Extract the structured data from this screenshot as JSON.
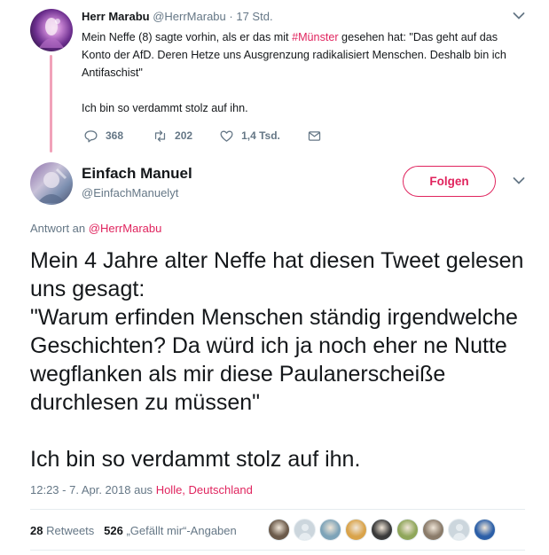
{
  "parent_tweet": {
    "author_name": "Herr Marabu",
    "author_handle": "@HerrMarabu",
    "separator": "·",
    "time": "17 Std.",
    "text_prefix": "Mein Neffe (8) sagte vorhin, als er das mit ",
    "hashtag": "#Münster",
    "text_suffix": " gesehen hat: \"Das geht auf das Konto der AfD. Deren Hetze uns Ausgrenzung radikalisiert Menschen. Deshalb bin ich Antifaschist\"",
    "text_second": "Ich bin so verdammt stolz auf ihn.",
    "replies": "368",
    "retweets": "202",
    "likes": "1,4 Tsd.",
    "caret": "⌄"
  },
  "main_tweet": {
    "author_name": "Einfach Manuel",
    "author_handle": "@EinfachManuelyt",
    "follow_label": "Folgen",
    "caret": "⌄",
    "reply_prefix": "Antwort an",
    "reply_mention": "@HerrMarabu",
    "text_lines": [
      "Mein 4 Jahre alter Neffe hat diesen Tweet gelesen uns gesagt:",
      "\"Warum erfinden Menschen ständig irgendwelche Geschichten? Da würd ich ja noch eher ne Nutte wegflanken als mir diese Paulanerscheiße durchlesen zu müssen\""
    ],
    "text_last": "Ich bin so verdammt stolz auf ihn.",
    "timestamp": "12:23 - 7. Apr. 2018 aus",
    "location": "Holle, Deutschland",
    "retweet_count": "28",
    "retweet_label": "Retweets",
    "like_count": "526",
    "like_label": "„Gefällt mir“-Angaben"
  },
  "liker_avatars": [
    {
      "name": "liker-avatar-1",
      "color": "#6b5a4a",
      "default": false
    },
    {
      "name": "liker-avatar-2",
      "color": "#ccd6dd",
      "default": true
    },
    {
      "name": "liker-avatar-3",
      "color": "#7da3b8",
      "default": false
    },
    {
      "name": "liker-avatar-4",
      "color": "#d9a34a",
      "default": false
    },
    {
      "name": "liker-avatar-5",
      "color": "#3a3a3a",
      "default": false
    },
    {
      "name": "liker-avatar-6",
      "color": "#8fa65a",
      "default": false
    },
    {
      "name": "liker-avatar-7",
      "color": "#8a7b6a",
      "default": false
    },
    {
      "name": "liker-avatar-8",
      "color": "#ccd6dd",
      "default": true
    },
    {
      "name": "liker-avatar-9",
      "color": "#2c5fa8",
      "default": false
    }
  ],
  "colors": {
    "accent": "#e0245e",
    "muted": "#657786",
    "thread_line": "#f1a2b9"
  }
}
